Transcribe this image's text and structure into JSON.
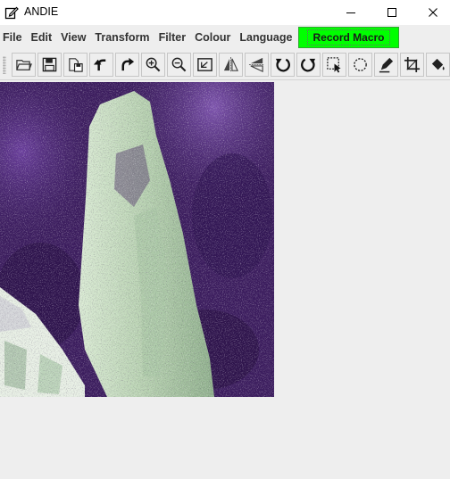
{
  "window": {
    "title": "ANDIE",
    "icons": [
      "edit-app-icon",
      "minimize-icon",
      "maximize-icon",
      "close-icon"
    ]
  },
  "menu": {
    "items": [
      "File",
      "Edit",
      "View",
      "Transform",
      "Filter",
      "Colour",
      "Language"
    ],
    "record_macro": "Record Macro"
  },
  "toolbar": {
    "tools": [
      {
        "name": "open-icon",
        "hint": "Open"
      },
      {
        "name": "save-icon",
        "hint": "Save"
      },
      {
        "name": "save-as-icon",
        "hint": "Save As"
      },
      {
        "name": "undo-icon",
        "hint": "Undo"
      },
      {
        "name": "redo-icon",
        "hint": "Redo"
      },
      {
        "name": "zoom-in-icon",
        "hint": "Zoom In"
      },
      {
        "name": "zoom-out-icon",
        "hint": "Zoom Out"
      },
      {
        "name": "zoom-fit-icon",
        "hint": "Zoom Full"
      },
      {
        "name": "flip-horizontal-icon",
        "hint": "Flip Horizontal"
      },
      {
        "name": "flip-vertical-icon",
        "hint": "Flip Vertical"
      },
      {
        "name": "rotate-left-icon",
        "hint": "Rotate Left"
      },
      {
        "name": "rotate-right-icon",
        "hint": "Rotate Right"
      },
      {
        "name": "rectangle-select-icon",
        "hint": "Select Region"
      },
      {
        "name": "ellipse-select-icon",
        "hint": "Ellipse"
      },
      {
        "name": "draw-icon",
        "hint": "Draw"
      },
      {
        "name": "crop-icon",
        "hint": "Crop"
      },
      {
        "name": "fill-icon",
        "hint": "Fill"
      }
    ]
  },
  "colors": {
    "record_macro_bg": "#00ff00",
    "image_purple": "#3b1c5e",
    "image_green": "#c7dcc0"
  }
}
